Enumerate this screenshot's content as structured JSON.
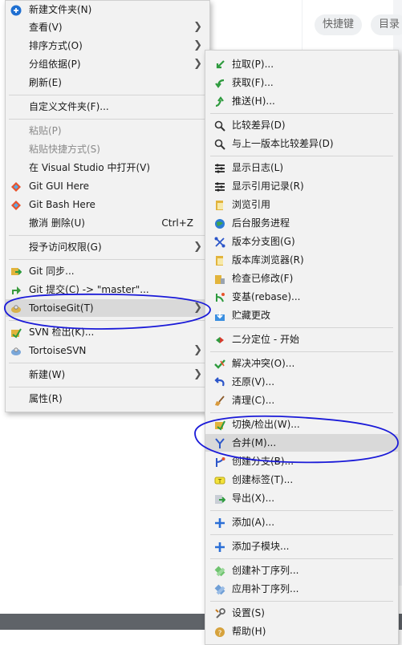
{
  "background": {
    "chips": [
      "快捷键",
      "目录"
    ]
  },
  "context_menu": {
    "items": [
      {
        "label": "新建文件夹(N)",
        "icon": "new-folder-icon"
      },
      {
        "label": "查看(V)",
        "submenu": true
      },
      {
        "label": "排序方式(O)",
        "submenu": true
      },
      {
        "label": "分组依据(P)",
        "submenu": true
      },
      {
        "label": "刷新(E)"
      },
      {
        "label": "自定义文件夹(F)..."
      },
      {
        "label": "粘贴(P)",
        "disabled": true
      },
      {
        "label": "粘贴快捷方式(S)",
        "disabled": true
      },
      {
        "label": "在 Visual Studio 中打开(V)"
      },
      {
        "label": "Git GUI Here",
        "icon": "git-gui-icon"
      },
      {
        "label": "Git Bash Here",
        "icon": "git-bash-icon"
      },
      {
        "label": "撤消 删除(U)",
        "shortcut": "Ctrl+Z"
      },
      {
        "label": "授予访问权限(G)",
        "submenu": true
      },
      {
        "label": "Git 同步...",
        "icon": "git-sync-icon"
      },
      {
        "label": "Git 提交(C) -> \"master\"...",
        "icon": "git-commit-icon"
      },
      {
        "label": "TortoiseGit(T)",
        "submenu": true,
        "highlighted": true,
        "icon": "tortoisegit-icon"
      },
      {
        "label": "SVN 检出(K)...",
        "icon": "svn-checkout-icon"
      },
      {
        "label": "TortoiseSVN",
        "submenu": true,
        "icon": "tortoisesvn-icon"
      },
      {
        "label": "新建(W)",
        "submenu": true
      },
      {
        "label": "属性(R)"
      }
    ]
  },
  "tortoisegit_submenu": {
    "items": [
      {
        "label": "拉取(P)...",
        "icon": "pull-icon"
      },
      {
        "label": "获取(F)...",
        "icon": "fetch-icon"
      },
      {
        "label": "推送(H)...",
        "icon": "push-icon"
      },
      {
        "label": "比较差异(D)",
        "icon": "diff-icon"
      },
      {
        "label": "与上一版本比较差异(D)",
        "icon": "diff-previous-icon"
      },
      {
        "label": "显示日志(L)",
        "icon": "show-log-icon"
      },
      {
        "label": "显示引用记录(R)",
        "icon": "reflog-icon"
      },
      {
        "label": "浏览引用",
        "icon": "browse-references-icon"
      },
      {
        "label": "后台服务进程",
        "icon": "daemon-icon"
      },
      {
        "label": "版本分支图(G)",
        "icon": "revision-graph-icon"
      },
      {
        "label": "版本库浏览器(R)",
        "icon": "repo-browser-icon"
      },
      {
        "label": "检查已修改(F)",
        "icon": "check-modifications-icon"
      },
      {
        "label": "变基(rebase)...",
        "icon": "rebase-icon"
      },
      {
        "label": "贮藏更改",
        "icon": "stash-icon"
      },
      {
        "label": "二分定位 - 开始",
        "icon": "bisect-icon"
      },
      {
        "label": "解决冲突(O)...",
        "icon": "resolve-icon"
      },
      {
        "label": "还原(V)...",
        "icon": "revert-icon"
      },
      {
        "label": "清理(C)...",
        "icon": "cleanup-icon"
      },
      {
        "label": "切换/检出(W)...",
        "icon": "switch-checkout-icon"
      },
      {
        "label": "合并(M)...",
        "icon": "merge-icon",
        "highlighted": true
      },
      {
        "label": "创建分支(B)...",
        "icon": "create-branch-icon"
      },
      {
        "label": "创建标签(T)...",
        "icon": "create-tag-icon"
      },
      {
        "label": "导出(X)...",
        "icon": "export-icon"
      },
      {
        "label": "添加(A)...",
        "icon": "add-icon"
      },
      {
        "label": "添加子模块...",
        "icon": "add-submodule-icon"
      },
      {
        "label": "创建补丁序列...",
        "icon": "create-patch-icon"
      },
      {
        "label": "应用补丁序列...",
        "icon": "apply-patch-icon"
      },
      {
        "label": "设置(S)",
        "icon": "settings-icon"
      },
      {
        "label": "帮助(H)",
        "icon": "help-icon"
      }
    ]
  },
  "colors": {
    "menu_background": "#f2f2f2",
    "highlight": "#d9d9d9",
    "annotation_pen": "#1a1ad8"
  }
}
